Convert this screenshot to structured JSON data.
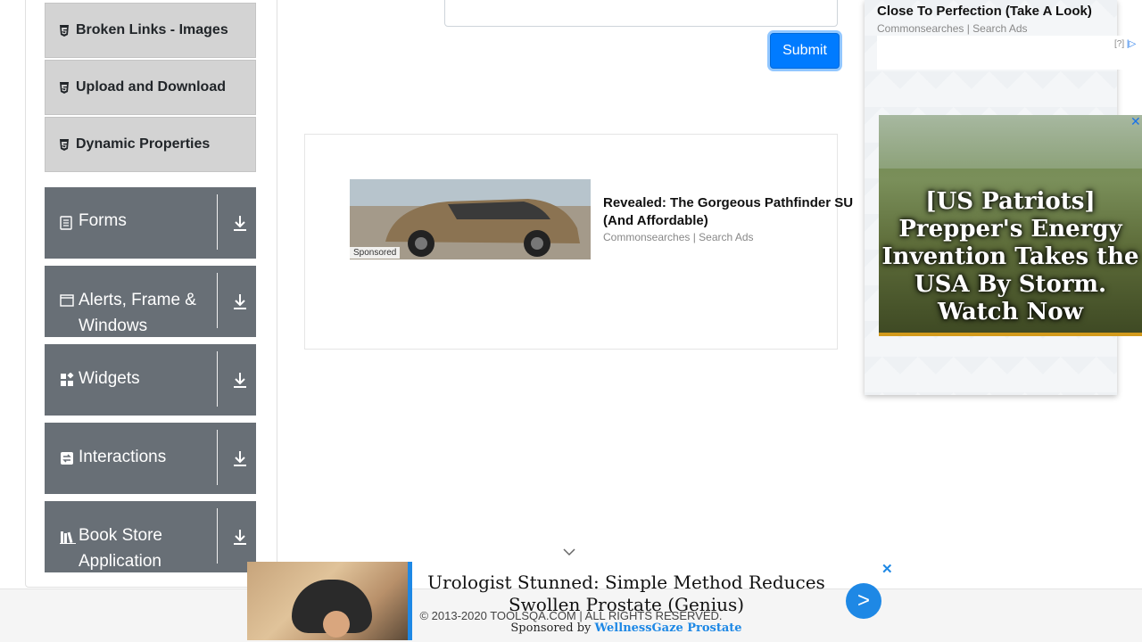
{
  "sidebar": {
    "sub_items": [
      {
        "label": "Broken Links - Images"
      },
      {
        "label": "Upload and Download"
      },
      {
        "label": "Dynamic Properties"
      }
    ],
    "groups": [
      {
        "label": "Forms",
        "icon": "form-icon"
      },
      {
        "label": "Alerts, Frame & Windows",
        "icon": "window-icon"
      },
      {
        "label": "Widgets",
        "icon": "widgets-icon"
      },
      {
        "label": "Interactions",
        "icon": "interactions-icon"
      },
      {
        "label": "Book Store Application",
        "icon": "books-icon"
      }
    ]
  },
  "form": {
    "submit_label": "Submit"
  },
  "main_ad": {
    "headline": "Revealed: The Gorgeous Pathfinder SUV (And Affordable)",
    "headline_line1": "Revealed: The Gorgeous Pathfinder SU",
    "headline_line2": "(And Affordable)",
    "source": "Commonsearches | Search Ads",
    "tag": "Sponsored"
  },
  "right_ad": {
    "headline": "Close To Perfection (Take A Look)",
    "source": "Commonsearches | Search Ads",
    "badge": "[?]",
    "video_text": "[US Patriots] Prepper's Energy Invention Takes the USA By Storm. Watch Now",
    "close": "✕"
  },
  "footer": {
    "copyright": "© 2013-2020 TOOLSQA.COM | ALL RIGHTS RESERVED."
  },
  "bottom_ad": {
    "headline": "Urologist Stunned: Simple Method Reduces Swollen Prostate (Genius)",
    "sponsor_prefix": "Sponsored by",
    "sponsor_name": "WellnessGaze Prostate",
    "go": ">",
    "close": "✕"
  },
  "colors": {
    "primary": "#007bff",
    "sidebar_group": "#686f76",
    "sidebar_sub": "#d3d3d3"
  }
}
